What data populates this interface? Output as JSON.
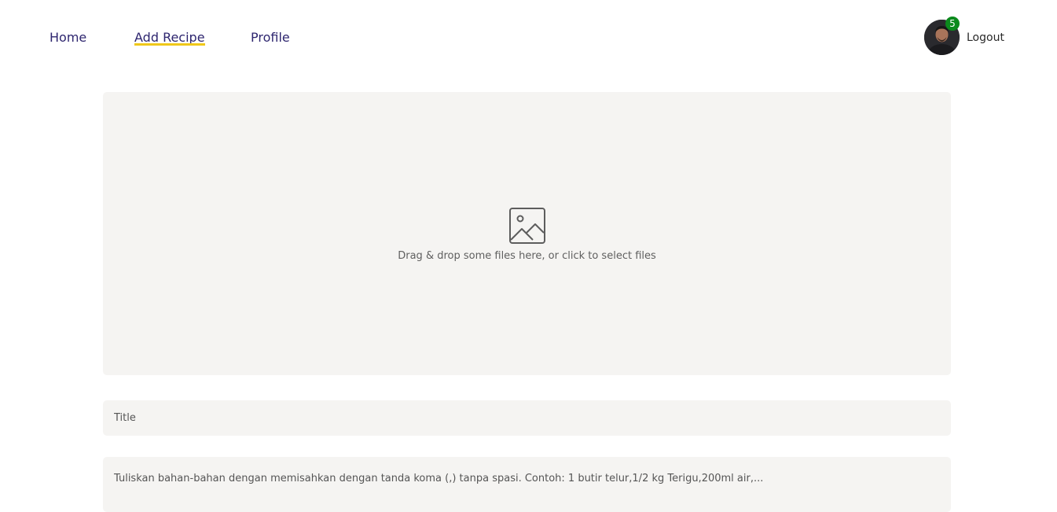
{
  "nav": {
    "home": "Home",
    "add_recipe": "Add Recipe",
    "profile": "Profile",
    "active_underline_color": "#efc81a"
  },
  "user": {
    "avatar_icon": "user-avatar",
    "badge_count": "5",
    "logout": "Logout"
  },
  "dropzone": {
    "icon": "image-icon",
    "text": "Drag & drop some files here, or click to select files"
  },
  "form": {
    "title_placeholder": "Title",
    "ingredients_placeholder": "Tuliskan bahan-bahan dengan memisahkan dengan tanda koma (,) tanpa spasi. Contoh: 1 butir telur,1/2 kg Terigu,200ml air,..."
  }
}
